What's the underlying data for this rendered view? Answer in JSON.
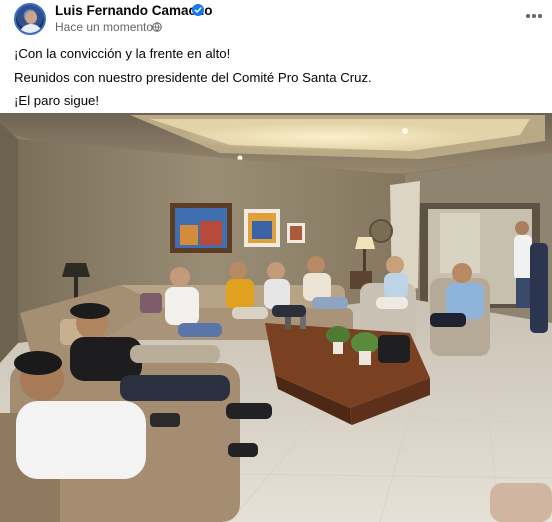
{
  "post": {
    "author": "Luis Fernando Camacho",
    "timestamp": "Hace un momento",
    "separator": "·",
    "caption_lines": [
      "¡Con la convicción y la frente en alto!",
      "Reunidos con nuestro presidente del Comité Pro Santa Cruz.",
      "¡El paro sigue!"
    ],
    "icons": {
      "verified": "verified-badge-icon",
      "audience": "globe-icon",
      "menu": "more-options-icon"
    },
    "colors": {
      "verified": "#1877f2",
      "meta_text": "#65676b",
      "name_text": "#050505"
    }
  }
}
